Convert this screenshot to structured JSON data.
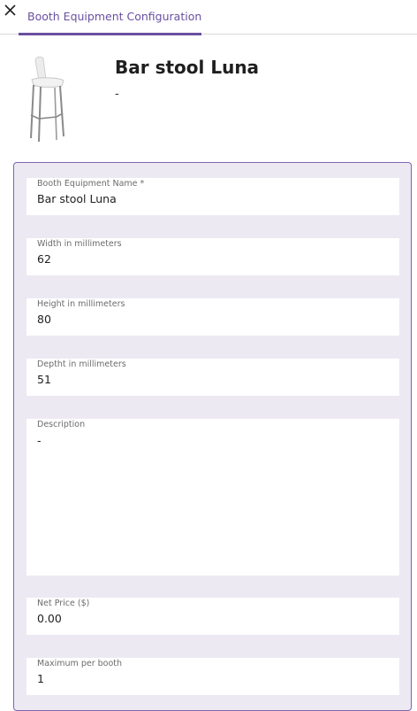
{
  "header": {
    "close_icon": "close-icon",
    "tab_label": "Booth Equipment Configuration",
    "accent_color": "#6a4fa0"
  },
  "product": {
    "image_icon": "bar-stool-image",
    "title": "Bar stool Luna",
    "subtitle": "-"
  },
  "form": {
    "fields": [
      {
        "label": "Booth Equipment Name *",
        "value": "Bar stool Luna"
      },
      {
        "label": "Width in millimeters",
        "value": "62"
      },
      {
        "label": "Height in millimeters",
        "value": "80"
      },
      {
        "label": "Deptht in millimeters",
        "value": "51"
      },
      {
        "label": "Description",
        "value": "-"
      },
      {
        "label": "Net Price ($)",
        "value": "0.00"
      },
      {
        "label": "Maximum per booth",
        "value": "1"
      }
    ]
  }
}
